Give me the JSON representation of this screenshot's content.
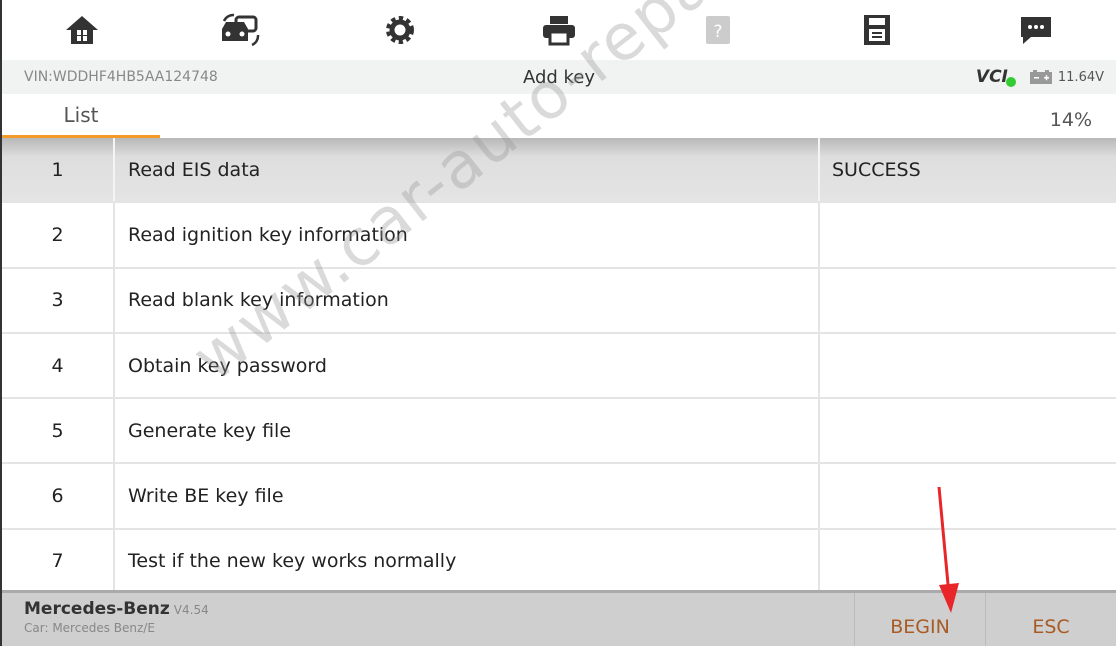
{
  "toolbar": {
    "icons": [
      "home-icon",
      "vehicle-switch-icon",
      "gear-icon",
      "printer-icon",
      "help-icon",
      "save-icon",
      "message-icon"
    ]
  },
  "info": {
    "vin": "VIN:WDDHF4HB5AA124748",
    "title": "Add key",
    "vci": "VCI",
    "voltage": "11.64V"
  },
  "tabs": {
    "list": "List",
    "progress": "14%"
  },
  "rows": [
    {
      "num": "1",
      "name": "Read EIS data",
      "status": "SUCCESS"
    },
    {
      "num": "2",
      "name": "Read ignition key information",
      "status": ""
    },
    {
      "num": "3",
      "name": "Read blank key information",
      "status": ""
    },
    {
      "num": "4",
      "name": "Obtain key password",
      "status": ""
    },
    {
      "num": "5",
      "name": "Generate key file",
      "status": ""
    },
    {
      "num": "6",
      "name": "Write BE key file",
      "status": ""
    },
    {
      "num": "7",
      "name": "Test if the new key works normally",
      "status": ""
    }
  ],
  "footer": {
    "brand": "Mercedes-Benz",
    "version": "V4.54",
    "car": "Car: Mercedes Benz/E",
    "begin": "BEGIN",
    "esc": "ESC"
  },
  "watermark": "www.car-auto-repair.com",
  "colors": {
    "accent": "#f39a2a",
    "button_text": "#a85b25",
    "arrow": "#e8262a"
  }
}
